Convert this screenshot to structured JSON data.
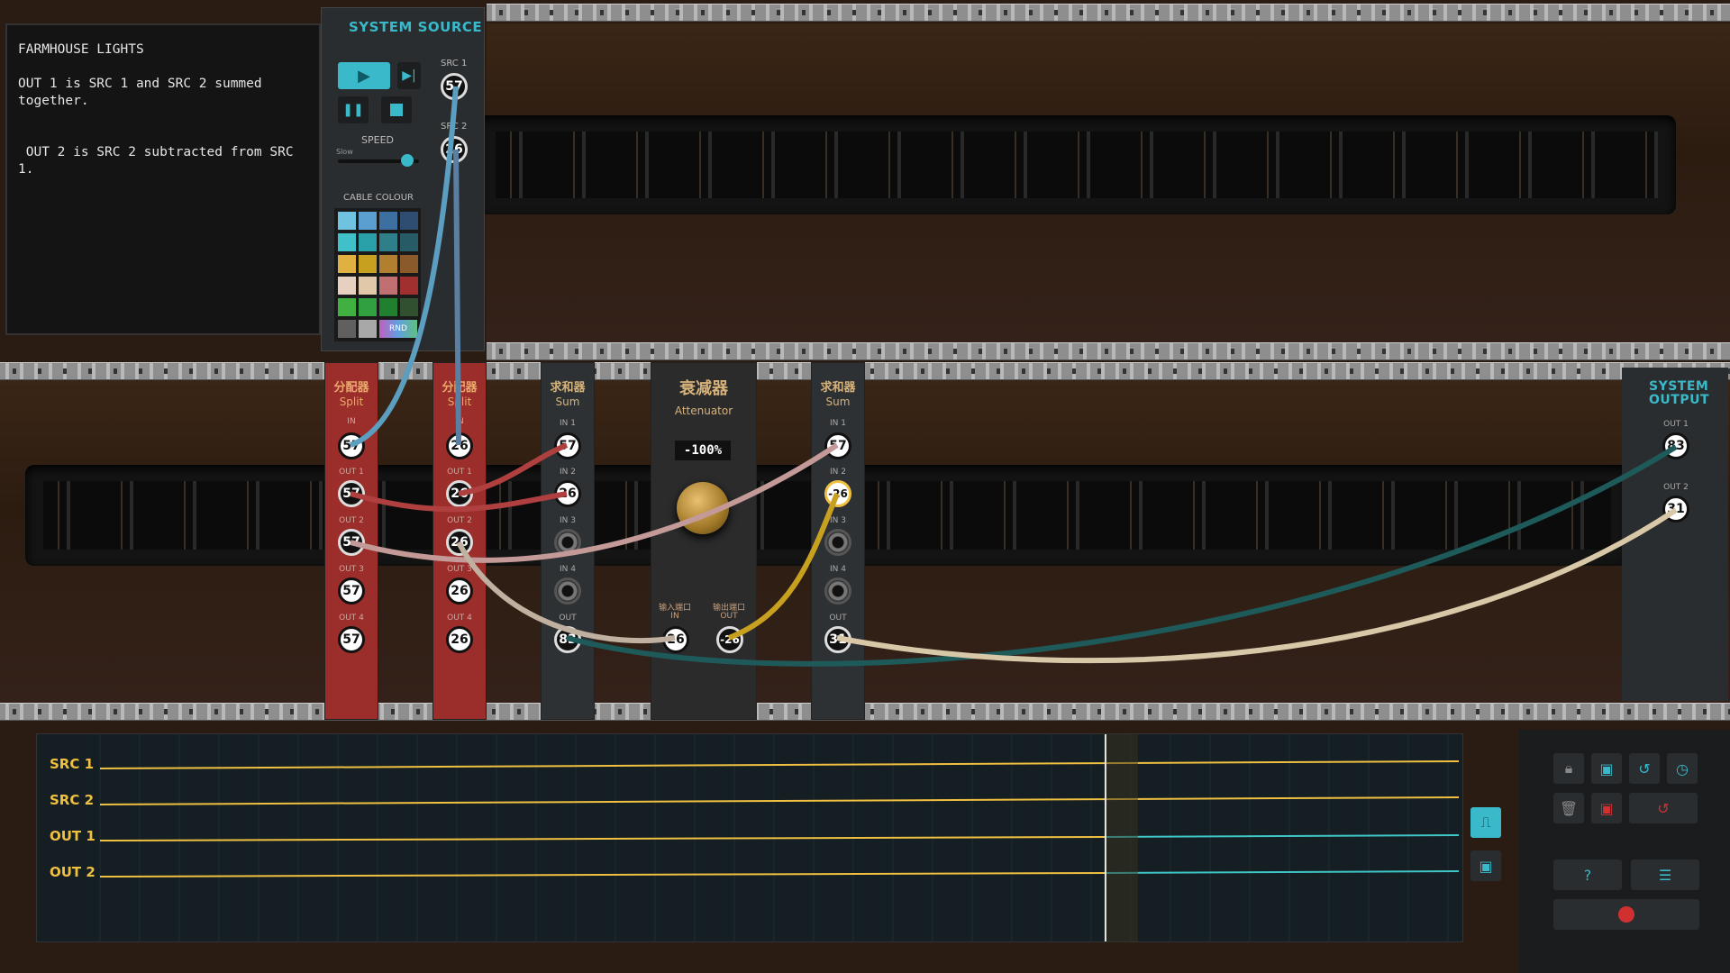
{
  "info_panel": {
    "text": "FARMHOUSE LIGHTS\n\nOUT 1 is SRC 1 and SRC 2 summed together.\n\n\n OUT 2 is SRC 2 subtracted from SRC 1."
  },
  "system_source": {
    "title": "SYSTEM SOURCE",
    "speed_label": "SPEED",
    "speed_slow": "Slow",
    "speed_value": 0.85,
    "cable_colour_label": "CABLE COLOUR",
    "rnd_label": "RND",
    "src1_label": "SRC 1",
    "src1_value": "57",
    "src2_label": "SRC 2",
    "src2_value": "26"
  },
  "swatch_colors": [
    "#6fc2e0",
    "#5a9fd0",
    "#3d6fa0",
    "#2e4d70",
    "#40c0c8",
    "#2aa0a8",
    "#2f7f8a",
    "#275c66",
    "#e0b040",
    "#c8a020",
    "#b07f30",
    "#8a5a2a",
    "#e8d0c0",
    "#e0c8a8",
    "#c07070",
    "#a03030",
    "#40b040",
    "#30a040",
    "#208030",
    "#305030",
    "#606060",
    "#a8a8a8",
    "#rnd",
    "#rnd"
  ],
  "modules": {
    "split1": {
      "cn": "分配器",
      "en": "Split",
      "in_label": "IN",
      "in": "57",
      "outs": [
        {
          "label": "OUT 1",
          "v": "57"
        },
        {
          "label": "OUT 2",
          "v": "57"
        },
        {
          "label": "OUT 3",
          "v": "57"
        },
        {
          "label": "OUT 4",
          "v": "57"
        }
      ]
    },
    "split2": {
      "cn": "分配器",
      "en": "Split",
      "in_label": "IN",
      "in": "26",
      "outs": [
        {
          "label": "OUT 1",
          "v": "26"
        },
        {
          "label": "OUT 2",
          "v": "26"
        },
        {
          "label": "OUT 3",
          "v": "26"
        },
        {
          "label": "OUT 4",
          "v": "26"
        }
      ]
    },
    "sum1": {
      "cn": "求和器",
      "en": "Sum",
      "ins": [
        {
          "label": "IN 1",
          "v": "57"
        },
        {
          "label": "IN 2",
          "v": "26"
        },
        {
          "label": "IN 3",
          "v": ""
        },
        {
          "label": "IN 4",
          "v": ""
        }
      ],
      "out_label": "OUT",
      "out": "83"
    },
    "atten": {
      "cn": "衰减器",
      "en": "Attenuator",
      "display": "-100%",
      "in_cn": "输入端口",
      "in_label": "IN",
      "in": "26",
      "out_cn": "输出端口",
      "out_label": "OUT",
      "out": "-26"
    },
    "sum2": {
      "cn": "求和器",
      "en": "Sum",
      "ins": [
        {
          "label": "IN 1",
          "v": "57"
        },
        {
          "label": "IN 2",
          "v": "-26"
        },
        {
          "label": "IN 3",
          "v": ""
        },
        {
          "label": "IN 4",
          "v": ""
        }
      ],
      "out_label": "OUT",
      "out": "31"
    }
  },
  "system_output": {
    "title": "SYSTEM OUTPUT",
    "out1_label": "OUT 1",
    "out1": "83",
    "out2_label": "OUT 2",
    "out2": "31"
  },
  "scope": {
    "rows": [
      "SRC 1",
      "SRC 2",
      "OUT 1",
      "OUT 2"
    ],
    "playhead": 0.74
  },
  "colors": {
    "accent": "#39b9c9",
    "trace_yellow": "#f0c040",
    "trace_teal": "#3fc7c7",
    "record_red": "#d03030"
  }
}
